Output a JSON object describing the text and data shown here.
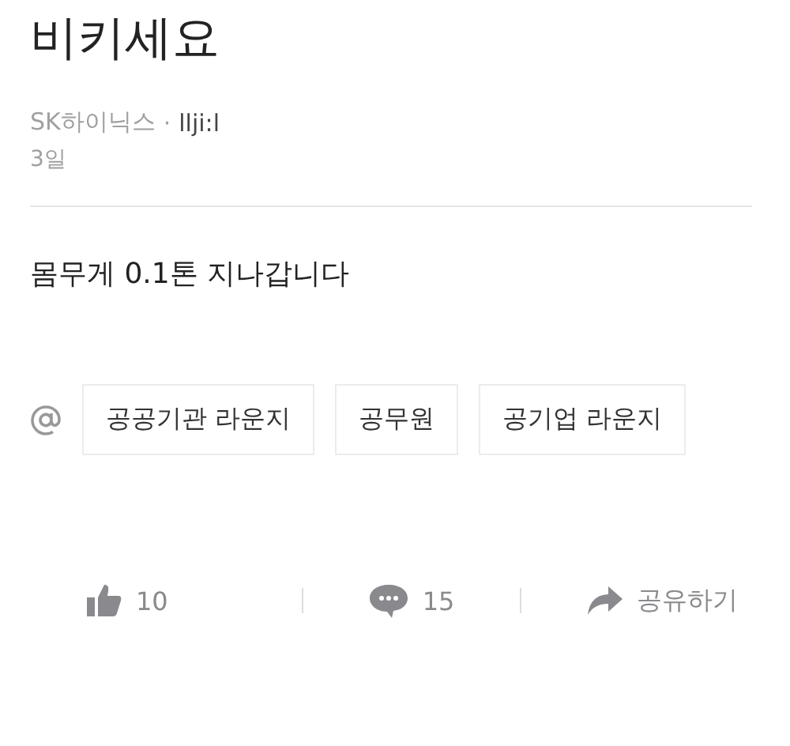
{
  "post": {
    "title": "비키세요",
    "company": "SK하이닉스",
    "separator": "·",
    "author": "llji:l",
    "time": "3일",
    "body": "몸무게 0.1톤 지나갑니다"
  },
  "tags": [
    {
      "label": "공공기관 라운지"
    },
    {
      "label": "공무원"
    },
    {
      "label": "공기업 라운지"
    }
  ],
  "actions": [
    {
      "kind": "like",
      "label": "10"
    },
    {
      "kind": "comment",
      "label": "15"
    },
    {
      "kind": "share",
      "label": "공유하기"
    }
  ]
}
